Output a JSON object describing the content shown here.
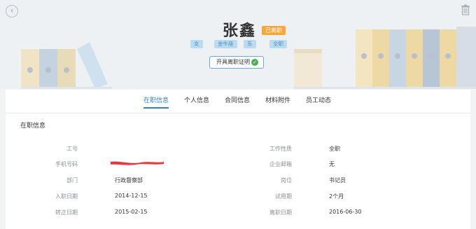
{
  "header": {
    "name": "张鑫",
    "status": "已离职",
    "tags": [
      "女",
      "金牛座",
      "东",
      "全职"
    ],
    "certificate_button": "开具离职证明"
  },
  "icons": {
    "back": "chevron-left-icon",
    "trash": "trash-icon",
    "check": "check-circle-icon"
  },
  "tabs": [
    "在职信息",
    "个人信息",
    "合同信息",
    "材料附件",
    "员工动态"
  ],
  "active_tab": 0,
  "section_title": "在职信息",
  "fields_left": [
    {
      "label": "工号",
      "value": ""
    },
    {
      "label": "手机号码",
      "value": ""
    },
    {
      "label": "部门",
      "value": "行政督察部"
    },
    {
      "label": "入职日期",
      "value": "2014-12-15"
    },
    {
      "label": "转正日期",
      "value": "2015-02-15"
    }
  ],
  "fields_right": [
    {
      "label": "工作性质",
      "value": "全职"
    },
    {
      "label": "企业邮箱",
      "value": "无"
    },
    {
      "label": "岗位",
      "value": "书记员"
    },
    {
      "label": "试用期",
      "value": "2个月"
    },
    {
      "label": "离职日期",
      "value": "2016-06-30"
    }
  ],
  "colors": {
    "accent": "#2f82c4",
    "status_badge": "#f7a637",
    "tag_bg": "#b9dcf0",
    "redaction": "#e8373a"
  }
}
